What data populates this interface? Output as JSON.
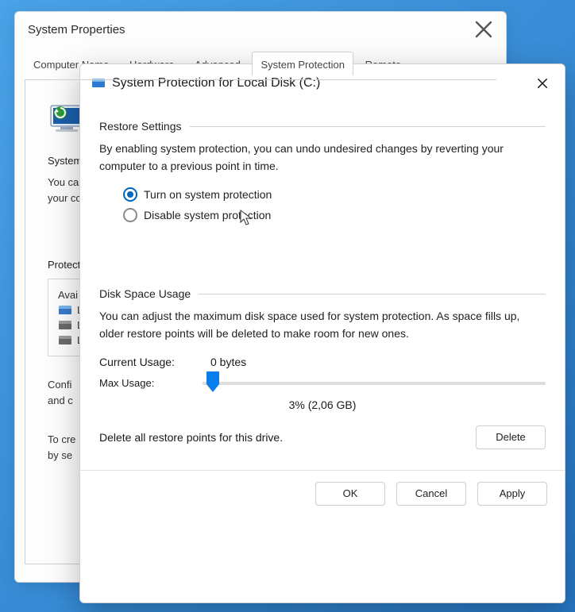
{
  "back_window": {
    "title": "System Properties",
    "tabs": {
      "t0": "Computer Name",
      "t1": "Hardware",
      "t2": "Advanced",
      "t3": "System Protection",
      "t4": "Remote"
    },
    "intro_stub": " ",
    "section_sr": "System",
    "line_youca": "You ca",
    "line_yourco": "your co",
    "section_ps": "Protecti",
    "box_label": "Avai",
    "row_l1": "L",
    "row_l2": "L",
    "row_l3": "L",
    "line_confi": "Confi",
    "line_andc": "and c",
    "line_tocre": "To cre",
    "line_byse": "by se"
  },
  "dialog": {
    "title": "System Protection for Local Disk (C:)",
    "restore_settings": {
      "legend": "Restore Settings",
      "description": "By enabling system protection, you can undo undesired changes by reverting your computer to a previous point in time.",
      "radio_on": "Turn on system protection",
      "radio_off": "Disable system protection"
    },
    "disk_space": {
      "legend": "Disk Space Usage",
      "description": "You can adjust the maximum disk space used for system protection. As space fills up, older restore points will be deleted to make room for new ones.",
      "current_label": "Current Usage:",
      "current_value": "0 bytes",
      "max_label": "Max Usage:",
      "slider_percent": 3,
      "slider_text": "3% (2,06 GB)",
      "delete_label": "Delete all restore points for this drive.",
      "delete_button": "Delete"
    },
    "buttons": {
      "ok": "OK",
      "cancel": "Cancel",
      "apply": "Apply"
    }
  }
}
